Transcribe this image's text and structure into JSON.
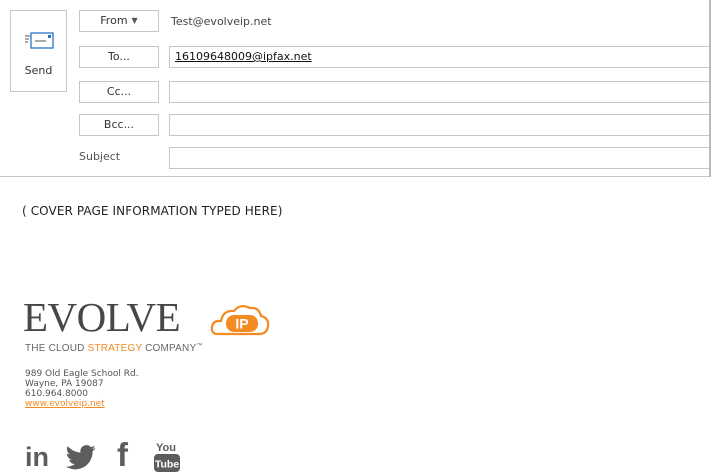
{
  "compose": {
    "send_label": "Send",
    "from_button": "From",
    "from_value": "Test@evolveip.net",
    "to_button": "To...",
    "to_recipient": "16109648009@ipfax.net",
    "cc_button": "Cc...",
    "cc_value": "",
    "bcc_button": "Bcc...",
    "bcc_value": "",
    "subject_label": "Subject",
    "subject_value": ""
  },
  "body": {
    "text": "( COVER PAGE INFORMATION TYPED HERE)"
  },
  "signature": {
    "logo_text": "EVOLVE",
    "logo_badge": "IP",
    "tagline_before": "THE CLOUD ",
    "tagline_highlight": "STRATEGY",
    "tagline_after": " COMPANY",
    "tagline_mark": "™",
    "address_line1": "989 Old Eagle School Rd.",
    "address_line2": "Wayne, PA 19087",
    "phone": "610.964.8000",
    "website": "www.evolveip.net",
    "social": {
      "linkedin": "in",
      "facebook": "f",
      "youtube_top": "You",
      "youtube_bottom": "Tube"
    },
    "accent_color": "#f28c22",
    "text_color": "#474747"
  }
}
